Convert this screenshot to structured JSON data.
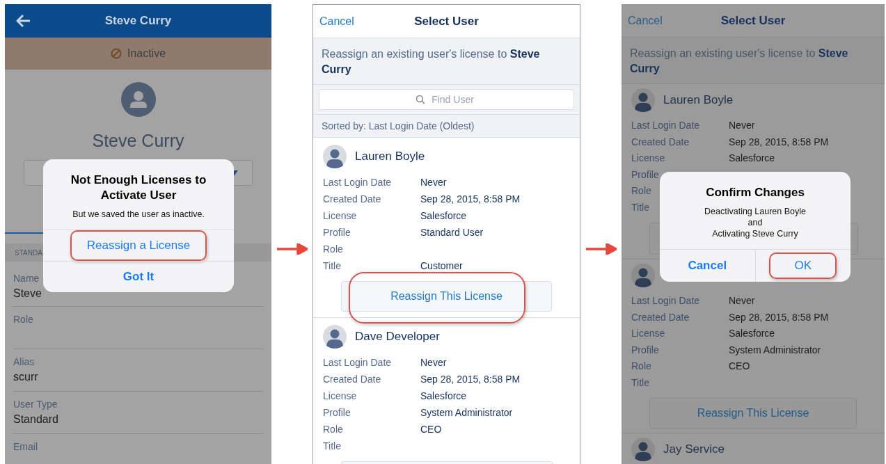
{
  "panels": [
    {
      "kind": "profile",
      "header": {
        "title": "Steve Curry"
      },
      "status": "Inactive",
      "name": "Steve Curry",
      "section_label": "STANDA",
      "fields": [
        {
          "label": "Name",
          "value": "Steve"
        },
        {
          "label": "Role"
        },
        {
          "label": "Alias",
          "value": "scurr"
        },
        {
          "label": "User Type",
          "value": "Standard"
        },
        {
          "label": "Email"
        }
      ],
      "dialog": {
        "kind": "stacked",
        "title": "Not Enough Licenses to Activate User",
        "message": "But we saved the user as inactive.",
        "actions": [
          {
            "label": "Reassign a License",
            "bold": false,
            "highlighted": true
          },
          {
            "label": "Got It",
            "bold": true,
            "highlighted": false
          }
        ]
      }
    },
    {
      "kind": "select_user",
      "cancel": "Cancel",
      "title": "Select User",
      "intro": "Reassign an existing user's license to **Steve Curry**",
      "search": {
        "placeholder": "Find User"
      },
      "sort_label": "Sorted by: Last Login Date (Oldest)",
      "users": [
        {
          "name": "Lauren Boyle",
          "details": [
            {
              "label": "Last Login Date",
              "value": "Never"
            },
            {
              "label": "Created Date",
              "value": "Sep 28, 2015, 8:58 PM"
            },
            {
              "label": "License",
              "value": "Salesforce"
            },
            {
              "label": "Profile",
              "value": "Standard User"
            },
            {
              "label": "Role"
            },
            {
              "label": "Title",
              "value": "Customer"
            }
          ],
          "action": {
            "label": "Reassign This License",
            "highlighted": true
          }
        },
        {
          "name": "Dave Developer",
          "details": [
            {
              "label": "Last Login Date",
              "value": "Never"
            },
            {
              "label": "Created Date",
              "value": "Sep 28, 2015, 8:58 PM"
            },
            {
              "label": "License",
              "value": "Salesforce"
            },
            {
              "label": "Profile",
              "value": "System Administrator"
            },
            {
              "label": "Role",
              "value": "CEO"
            },
            {
              "label": "Title"
            }
          ]
        }
      ]
    },
    {
      "kind": "select_user",
      "cancel": "Cancel",
      "title": "Select User",
      "intro": "Reassign an existing user's license to **Steve Curry**",
      "users": [
        {
          "name": "Lauren Boyle",
          "details": [
            {
              "label": "Last Login Date",
              "value": "Never"
            },
            {
              "label": "Created Date",
              "value": "Sep 28, 2015, 8:58 PM"
            },
            {
              "label": "License",
              "value": "Salesforce"
            },
            {
              "label": "Profile"
            },
            {
              "label": "Role"
            },
            {
              "label": "Title"
            }
          ]
        },
        {
          "details": [
            {
              "label": "Last Login Date",
              "value": "Never"
            },
            {
              "label": "Created Date",
              "value": "Sep 28, 2015, 8:58 PM"
            },
            {
              "label": "License",
              "value": "Salesforce"
            },
            {
              "label": "Profile",
              "value": "System Administrator"
            },
            {
              "label": "Role",
              "value": "CEO"
            },
            {
              "label": "Title"
            }
          ],
          "action": {
            "label": "Reassign This License"
          }
        },
        {
          "name": "Jay Service"
        }
      ],
      "dialog": {
        "kind": "row",
        "title": "Confirm Changes",
        "message": "Deactivating Lauren Boyle\nand\nActivating Steve Curry",
        "actions": [
          {
            "label": "Cancel",
            "bold": true,
            "highlighted": false
          },
          {
            "label": "OK",
            "bold": false,
            "highlighted": true
          }
        ]
      }
    }
  ]
}
